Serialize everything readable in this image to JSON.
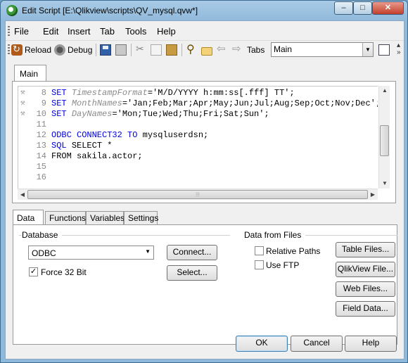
{
  "window": {
    "title": "Edit Script [E:\\Qlikview\\scripts\\QV_mysql.qvw*]",
    "controls": {
      "minimize": "‒",
      "maximize": "□",
      "close": "✕"
    }
  },
  "menu": [
    "File",
    "Edit",
    "Insert",
    "Tab",
    "Tools",
    "Help"
  ],
  "toolbar": {
    "reload_label": "Reload",
    "debug_label": "Debug",
    "tabs_label": "Tabs",
    "tabs_value": "Main"
  },
  "script_tab": "Main",
  "editor": {
    "lines": [
      {
        "n": "8",
        "marker": true,
        "parts": [
          {
            "t": "SET ",
            "c": "k"
          },
          {
            "t": "TimestampFormat",
            "c": "v"
          },
          {
            "t": "='M/D/YYYY h:mm:ss[.fff] TT';",
            "c": "s"
          }
        ]
      },
      {
        "n": "9",
        "marker": true,
        "parts": [
          {
            "t": "SET ",
            "c": "k"
          },
          {
            "t": "MonthNames",
            "c": "v"
          },
          {
            "t": "='Jan;Feb;Mar;Apr;May;Jun;Jul;Aug;Sep;Oct;Nov;Dec';",
            "c": "s"
          }
        ]
      },
      {
        "n": "10",
        "marker": true,
        "parts": [
          {
            "t": "SET ",
            "c": "k"
          },
          {
            "t": "DayNames",
            "c": "v"
          },
          {
            "t": "='Mon;Tue;Wed;Thu;Fri;Sat;Sun';",
            "c": "s"
          }
        ]
      },
      {
        "n": "11",
        "marker": false,
        "parts": []
      },
      {
        "n": "12",
        "marker": false,
        "parts": [
          {
            "t": "ODBC CONNECT32 TO ",
            "c": "k"
          },
          {
            "t": "mysqluserdsn;",
            "c": "s"
          }
        ]
      },
      {
        "n": "13",
        "marker": false,
        "parts": [
          {
            "t": "SQL ",
            "c": "k"
          },
          {
            "t": "SELECT *",
            "c": "s"
          }
        ]
      },
      {
        "n": "14",
        "marker": false,
        "parts": [
          {
            "t": "FROM sakila.actor;",
            "c": "s"
          }
        ]
      },
      {
        "n": "15",
        "marker": false,
        "parts": []
      },
      {
        "n": "16",
        "marker": false,
        "parts": []
      }
    ]
  },
  "bottom_tabs": [
    "Data",
    "Functions",
    "Variables",
    "Settings"
  ],
  "data_panel": {
    "database_label": "Database",
    "database_value": "ODBC",
    "connect_button": "Connect...",
    "select_button": "Select...",
    "force32_label": "Force 32 Bit",
    "force32_checked": true,
    "files_label": "Data from Files",
    "relative_paths_label": "Relative Paths",
    "relative_paths_checked": false,
    "use_ftp_label": "Use FTP",
    "use_ftp_checked": false,
    "table_files_button": "Table Files...",
    "qlikview_file_button": "QlikView File...",
    "web_files_button": "Web Files...",
    "field_data_button": "Field Data..."
  },
  "footer": {
    "ok": "OK",
    "cancel": "Cancel",
    "help": "Help"
  }
}
